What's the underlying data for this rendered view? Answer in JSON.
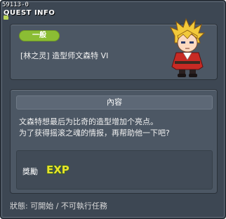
{
  "header": {
    "quest_id": "59113-0",
    "title": "QUEST INFO"
  },
  "quest": {
    "category": "一般",
    "name": "[林之灵] 造型师文森特 VI"
  },
  "content": {
    "section_title": "內容",
    "description": [
      "文森特想最后为比奇的造型增加个亮点。",
      "为了获得摇滚之魂的情报，再帮助他一下吧?"
    ]
  },
  "reward": {
    "label": "獎勵",
    "icon": "exp-icon",
    "icon_text": "EXP"
  },
  "status": {
    "text": "狀態:  可開始  / 不可執行任務"
  },
  "colors": {
    "window_bg": "#3d4753",
    "panel_bg": "#4c5764",
    "badge_green": "#8bbd34",
    "exp_yellow": "#e8e22a"
  }
}
